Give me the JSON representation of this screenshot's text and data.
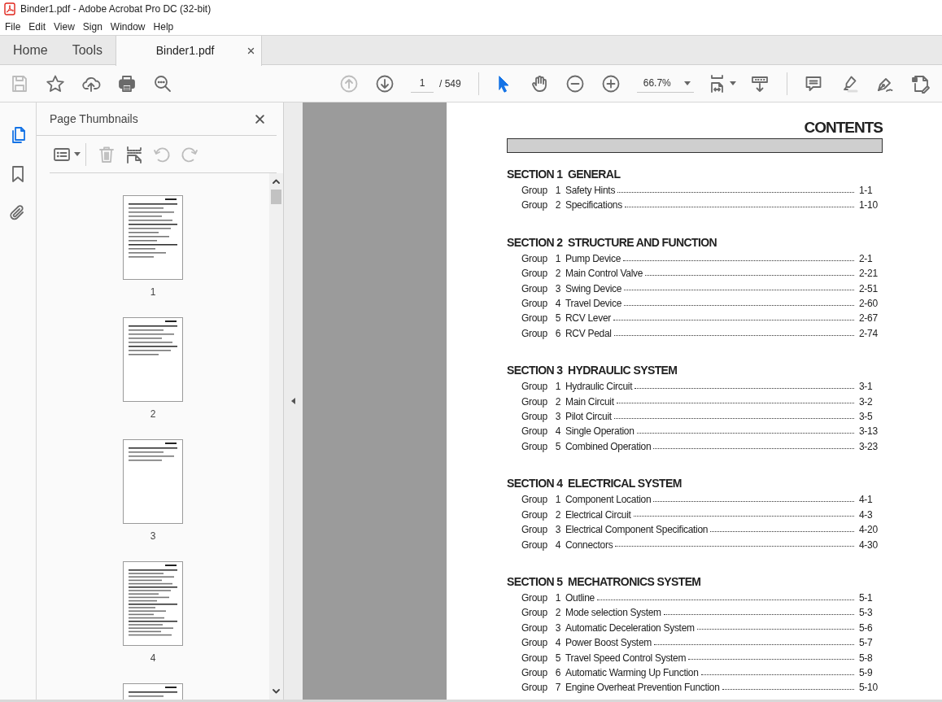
{
  "window": {
    "title": "Binder1.pdf - Adobe Acrobat Pro DC (32-bit)"
  },
  "menu": [
    "File",
    "Edit",
    "View",
    "Sign",
    "Window",
    "Help"
  ],
  "tabs": [
    {
      "label": "Home",
      "selected": false
    },
    {
      "label": "Tools",
      "selected": false
    },
    {
      "label": "Binder1.pdf",
      "selected": true
    }
  ],
  "toolbar": {
    "quick_tools": [
      {
        "kind": "save",
        "disabled": true
      },
      {
        "kind": "star",
        "disabled": false
      },
      {
        "kind": "upload",
        "disabled": false
      },
      {
        "kind": "print",
        "disabled": false
      },
      {
        "kind": "zoom-search",
        "disabled": false
      }
    ],
    "page_buttons": [
      {
        "kind": "previous",
        "disabled": true
      },
      {
        "kind": "next",
        "disabled": false
      }
    ],
    "page_field": {
      "value": "1"
    },
    "page_count": "/ 549",
    "mode_tools": [
      {
        "kind": "select",
        "selected": true
      },
      {
        "kind": "hand",
        "selected": false
      }
    ],
    "zoom_buttons": [
      {
        "kind": "zoom-out"
      },
      {
        "kind": "zoom-in"
      }
    ],
    "zoom_field": {
      "value": "66.7%"
    },
    "view_tools": [
      {
        "kind": "fit"
      },
      {
        "kind": "scroll"
      }
    ],
    "comment_tools": [
      {
        "kind": "comment"
      },
      {
        "kind": "highlight"
      },
      {
        "kind": "sign"
      },
      {
        "kind": "edit"
      }
    ]
  },
  "sidebar": {
    "items": [
      {
        "kind": "pages",
        "selected": true
      },
      {
        "kind": "bookmarks",
        "selected": false
      },
      {
        "kind": "attachments",
        "selected": false
      }
    ]
  },
  "panel": {
    "title": "Page Thumbnails",
    "tools": [
      {
        "kind": "options",
        "disabled": false
      },
      {
        "kind": "delete",
        "disabled": true
      },
      {
        "kind": "insert",
        "disabled": false
      },
      {
        "kind": "rotate-left",
        "disabled": true
      },
      {
        "kind": "rotate-right",
        "disabled": true
      }
    ],
    "thumbnails": [
      {
        "kind": "picture",
        "label": "1"
      },
      {
        "kind": "picture",
        "label": "2"
      },
      {
        "kind": "picture",
        "label": "3"
      },
      {
        "kind": "picture",
        "label": "4"
      },
      {
        "kind": "picture"
      }
    ]
  },
  "document": {
    "heading": "CONTENTS",
    "sections": [
      {
        "title": "SECTION 1  GENERAL",
        "groups": [
          {
            "label": "Group",
            "number": "1",
            "title": "Safety Hints",
            "page": "1-1"
          },
          {
            "label": "Group",
            "number": "2",
            "title": "Specifications",
            "page": "1-10"
          }
        ]
      },
      {
        "title": "SECTION 2  STRUCTURE AND FUNCTION",
        "groups": [
          {
            "label": "Group",
            "number": "1",
            "title": "Pump Device",
            "page": "2-1"
          },
          {
            "label": "Group",
            "number": "2",
            "title": "Main Control Valve",
            "page": "2-21"
          },
          {
            "label": "Group",
            "number": "3",
            "title": "Swing Device",
            "page": "2-51"
          },
          {
            "label": "Group",
            "number": "4",
            "title": "Travel Device",
            "page": "2-60"
          },
          {
            "label": "Group",
            "number": "5",
            "title": "RCV Lever",
            "page": "2-67"
          },
          {
            "label": "Group",
            "number": "6",
            "title": "RCV Pedal",
            "page": "2-74"
          }
        ]
      },
      {
        "title": "SECTION 3  HYDRAULIC SYSTEM",
        "groups": [
          {
            "label": "Group",
            "number": "1",
            "title": "Hydraulic Circuit",
            "page": "3-1"
          },
          {
            "label": "Group",
            "number": "2",
            "title": "Main Circuit",
            "page": "3-2"
          },
          {
            "label": "Group",
            "number": "3",
            "title": "Pilot Circuit",
            "page": "3-5"
          },
          {
            "label": "Group",
            "number": "4",
            "title": "Single Operation",
            "page": "3-13"
          },
          {
            "label": "Group",
            "number": "5",
            "title": "Combined Operation",
            "page": "3-23"
          }
        ]
      },
      {
        "title": "SECTION 4  ELECTRICAL SYSTEM",
        "groups": [
          {
            "label": "Group",
            "number": "1",
            "title": "Component Location",
            "page": "4-1"
          },
          {
            "label": "Group",
            "number": "2",
            "title": "Electrical Circuit",
            "page": "4-3"
          },
          {
            "label": "Group",
            "number": "3",
            "title": "Electrical Component Specification",
            "page": "4-20"
          },
          {
            "label": "Group",
            "number": "4",
            "title": "Connectors",
            "page": "4-30"
          }
        ]
      },
      {
        "title": "SECTION 5  MECHATRONICS SYSTEM",
        "groups": [
          {
            "label": "Group",
            "number": "1",
            "title": "Outline",
            "page": "5-1"
          },
          {
            "label": "Group",
            "number": "2",
            "title": "Mode selection System",
            "page": "5-3"
          },
          {
            "label": "Group",
            "number": "3",
            "title": "Automatic Deceleration System",
            "page": "5-6"
          },
          {
            "label": "Group",
            "number": "4",
            "title": "Power Boost System",
            "page": "5-7"
          },
          {
            "label": "Group",
            "number": "5",
            "title": "Travel Speed Control System",
            "page": "5-8"
          },
          {
            "label": "Group",
            "number": "6",
            "title": "Automatic Warming Up Function",
            "page": "5-9"
          },
          {
            "label": "Group",
            "number": "7",
            "title": "Engine Overheat Prevention Function",
            "page": "5-10"
          }
        ]
      }
    ]
  }
}
